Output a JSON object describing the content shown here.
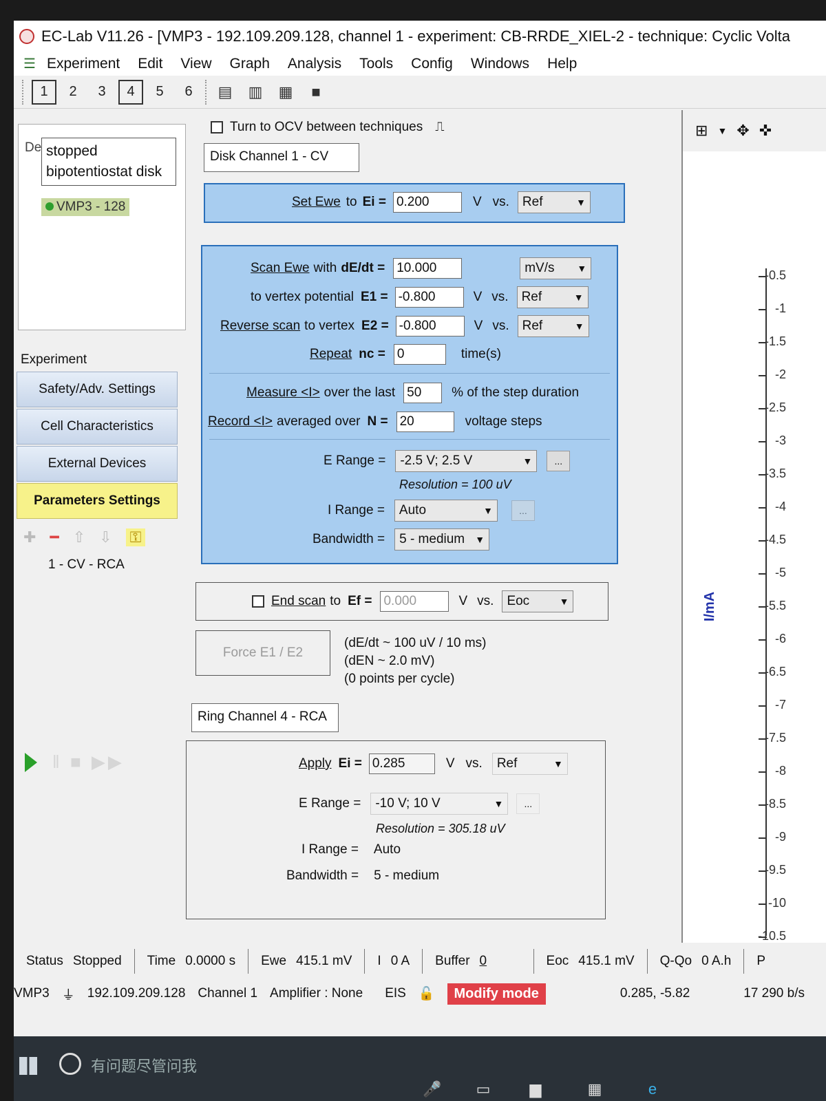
{
  "window": {
    "title": "EC-Lab V11.26 - [VMP3 - 192.109.209.128, channel 1 - experiment: CB-RRDE_XIEL-2 - technique: Cyclic Volta"
  },
  "menu": [
    "Experiment",
    "Edit",
    "View",
    "Graph",
    "Analysis",
    "Tools",
    "Config",
    "Windows",
    "Help"
  ],
  "toolbar": {
    "channels": [
      "1",
      "2",
      "3",
      "4",
      "5",
      "6"
    ]
  },
  "left": {
    "device_label": "De",
    "tooltip_line1": "stopped",
    "tooltip_line2": "bipotentiostat disk",
    "device_item": "VMP3 - 128",
    "experiment_header": "Experiment",
    "buttons": [
      "Safety/Adv. Settings",
      "Cell Characteristics",
      "External Devices",
      "Parameters Settings"
    ],
    "sequence_item": "1 - CV - RCA"
  },
  "disk": {
    "ocv_label": "Turn to OCV between techniques",
    "tab_label": "Disk Channel 1 - CV",
    "set_ewe_label": "Set Ewe",
    "to_label": "to",
    "ei_label": "Ei =",
    "ei_value": "0.200",
    "ei_unit": "V",
    "vs_label": "vs.",
    "ei_ref": "Ref",
    "scan_label": "Scan Ewe",
    "with_label": "with",
    "dedt_label": "dE/dt =",
    "dedt_value": "10.000",
    "dedt_unit": "mV/s",
    "vertex1_label": "to vertex potential",
    "e1_label": "E1 =",
    "e1_value": "-0.800",
    "e1_unit": "V",
    "e1_ref": "Ref",
    "reverse_label": "Reverse scan",
    "reverse_rest": "to vertex",
    "e2_label": "E2 =",
    "e2_value": "-0.800",
    "e2_unit": "V",
    "e2_ref": "Ref",
    "repeat_label": "Repeat",
    "nc_label": "nc =",
    "nc_value": "0",
    "nc_unit": "time(s)",
    "measure_label": "Measure <I>",
    "measure_rest": "over the last",
    "measure_value": "50",
    "measure_unit": "% of the step duration",
    "record_label": "Record <I>",
    "record_rest": "averaged over",
    "n_label": "N =",
    "n_value": "20",
    "n_unit": "voltage steps",
    "erange_label": "E Range =",
    "erange_value": "-2.5 V; 2.5 V",
    "resolution": "Resolution = 100 uV",
    "irange_label": "I Range =",
    "irange_value": "Auto",
    "bandwidth_label": "Bandwidth =",
    "bandwidth_value": "5 - medium",
    "endscan_label": "End scan",
    "endscan_rest": "to",
    "ef_label": "Ef =",
    "ef_value": "0.000",
    "ef_unit": "V",
    "ef_ref": "Eoc",
    "force_label": "Force E1 / E2",
    "info1": "(dE/dt ~ 100 uV / 10 ms)",
    "info2": "(dEN ~ 2.0 mV)",
    "info3": "(0 points per cycle)"
  },
  "ring": {
    "tab_label": "Ring Channel 4 - RCA",
    "apply_label": "Apply",
    "ei_label": "Ei =",
    "ei_value": "0.285",
    "ei_unit": "V",
    "vs_label": "vs.",
    "ei_ref": "Ref",
    "erange_label": "E Range =",
    "erange_value": "-10 V; 10 V",
    "resolution": "Resolution = 305.18 uV",
    "irange_label": "I Range =",
    "irange_value": "Auto",
    "bandwidth_label": "Bandwidth =",
    "bandwidth_value": "5 - medium"
  },
  "graph": {
    "ylabel": "I/mA",
    "yticks": [
      "-0.5",
      "-1",
      "-1.5",
      "-2",
      "-2.5",
      "-3",
      "-3.5",
      "-4",
      "-4.5",
      "-5",
      "-5.5",
      "-6",
      "-6.5",
      "-7",
      "-7.5",
      "-8",
      "-8.5",
      "-9",
      "-9.5",
      "-10",
      "-10.5"
    ]
  },
  "status": {
    "status_label": "Status",
    "status_value": "Stopped",
    "time_label": "Time",
    "time_value": "0.0000 s",
    "ewe_label": "Ewe",
    "ewe_value": "415.1 mV",
    "i_label": "I",
    "i_value": "0 A",
    "buffer_label": "Buffer",
    "buffer_value": "0",
    "eoc_label": "Eoc",
    "eoc_value": "415.1 mV",
    "qqo_label": "Q-Qo",
    "qqo_value": "0 A.h",
    "p_label": "P"
  },
  "status2": {
    "device": "VMP3",
    "ip": "192.109.209.128",
    "channel": "Channel 1",
    "amplifier": "Amplifier : None",
    "eis": "EIS",
    "modify": "Modify mode",
    "coords": "0.285, -5.82",
    "rate": "17 290 b/s"
  },
  "taskbar": {
    "search_placeholder": "有问题尽管问我"
  }
}
